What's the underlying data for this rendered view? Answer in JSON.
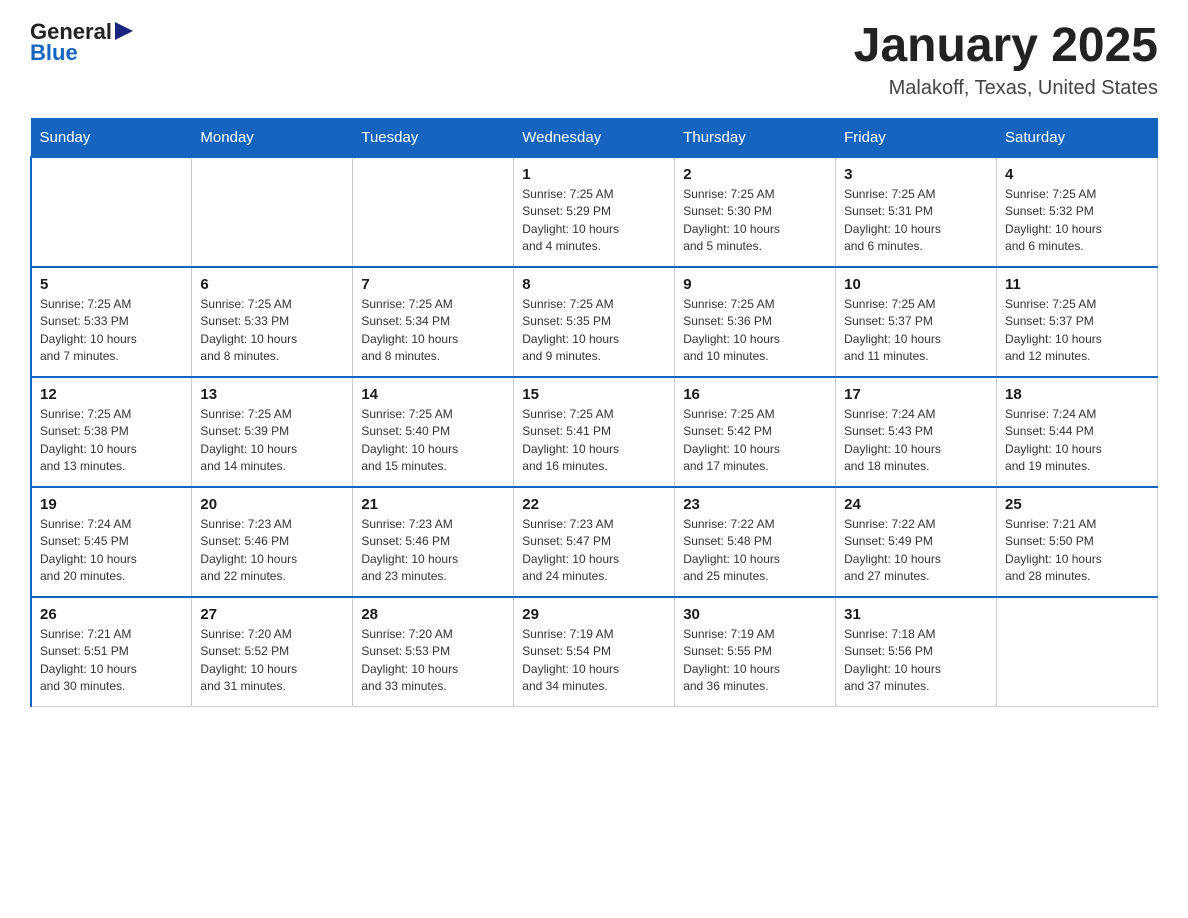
{
  "header": {
    "logo_general": "General",
    "logo_blue": "Blue",
    "calendar_title": "January 2025",
    "calendar_subtitle": "Malakoff, Texas, United States"
  },
  "days_of_week": [
    "Sunday",
    "Monday",
    "Tuesday",
    "Wednesday",
    "Thursday",
    "Friday",
    "Saturday"
  ],
  "weeks": [
    [
      {
        "day": "",
        "info": ""
      },
      {
        "day": "",
        "info": ""
      },
      {
        "day": "",
        "info": ""
      },
      {
        "day": "1",
        "info": "Sunrise: 7:25 AM\nSunset: 5:29 PM\nDaylight: 10 hours\nand 4 minutes."
      },
      {
        "day": "2",
        "info": "Sunrise: 7:25 AM\nSunset: 5:30 PM\nDaylight: 10 hours\nand 5 minutes."
      },
      {
        "day": "3",
        "info": "Sunrise: 7:25 AM\nSunset: 5:31 PM\nDaylight: 10 hours\nand 6 minutes."
      },
      {
        "day": "4",
        "info": "Sunrise: 7:25 AM\nSunset: 5:32 PM\nDaylight: 10 hours\nand 6 minutes."
      }
    ],
    [
      {
        "day": "5",
        "info": "Sunrise: 7:25 AM\nSunset: 5:33 PM\nDaylight: 10 hours\nand 7 minutes."
      },
      {
        "day": "6",
        "info": "Sunrise: 7:25 AM\nSunset: 5:33 PM\nDaylight: 10 hours\nand 8 minutes."
      },
      {
        "day": "7",
        "info": "Sunrise: 7:25 AM\nSunset: 5:34 PM\nDaylight: 10 hours\nand 8 minutes."
      },
      {
        "day": "8",
        "info": "Sunrise: 7:25 AM\nSunset: 5:35 PM\nDaylight: 10 hours\nand 9 minutes."
      },
      {
        "day": "9",
        "info": "Sunrise: 7:25 AM\nSunset: 5:36 PM\nDaylight: 10 hours\nand 10 minutes."
      },
      {
        "day": "10",
        "info": "Sunrise: 7:25 AM\nSunset: 5:37 PM\nDaylight: 10 hours\nand 11 minutes."
      },
      {
        "day": "11",
        "info": "Sunrise: 7:25 AM\nSunset: 5:37 PM\nDaylight: 10 hours\nand 12 minutes."
      }
    ],
    [
      {
        "day": "12",
        "info": "Sunrise: 7:25 AM\nSunset: 5:38 PM\nDaylight: 10 hours\nand 13 minutes."
      },
      {
        "day": "13",
        "info": "Sunrise: 7:25 AM\nSunset: 5:39 PM\nDaylight: 10 hours\nand 14 minutes."
      },
      {
        "day": "14",
        "info": "Sunrise: 7:25 AM\nSunset: 5:40 PM\nDaylight: 10 hours\nand 15 minutes."
      },
      {
        "day": "15",
        "info": "Sunrise: 7:25 AM\nSunset: 5:41 PM\nDaylight: 10 hours\nand 16 minutes."
      },
      {
        "day": "16",
        "info": "Sunrise: 7:25 AM\nSunset: 5:42 PM\nDaylight: 10 hours\nand 17 minutes."
      },
      {
        "day": "17",
        "info": "Sunrise: 7:24 AM\nSunset: 5:43 PM\nDaylight: 10 hours\nand 18 minutes."
      },
      {
        "day": "18",
        "info": "Sunrise: 7:24 AM\nSunset: 5:44 PM\nDaylight: 10 hours\nand 19 minutes."
      }
    ],
    [
      {
        "day": "19",
        "info": "Sunrise: 7:24 AM\nSunset: 5:45 PM\nDaylight: 10 hours\nand 20 minutes."
      },
      {
        "day": "20",
        "info": "Sunrise: 7:23 AM\nSunset: 5:46 PM\nDaylight: 10 hours\nand 22 minutes."
      },
      {
        "day": "21",
        "info": "Sunrise: 7:23 AM\nSunset: 5:46 PM\nDaylight: 10 hours\nand 23 minutes."
      },
      {
        "day": "22",
        "info": "Sunrise: 7:23 AM\nSunset: 5:47 PM\nDaylight: 10 hours\nand 24 minutes."
      },
      {
        "day": "23",
        "info": "Sunrise: 7:22 AM\nSunset: 5:48 PM\nDaylight: 10 hours\nand 25 minutes."
      },
      {
        "day": "24",
        "info": "Sunrise: 7:22 AM\nSunset: 5:49 PM\nDaylight: 10 hours\nand 27 minutes."
      },
      {
        "day": "25",
        "info": "Sunrise: 7:21 AM\nSunset: 5:50 PM\nDaylight: 10 hours\nand 28 minutes."
      }
    ],
    [
      {
        "day": "26",
        "info": "Sunrise: 7:21 AM\nSunset: 5:51 PM\nDaylight: 10 hours\nand 30 minutes."
      },
      {
        "day": "27",
        "info": "Sunrise: 7:20 AM\nSunset: 5:52 PM\nDaylight: 10 hours\nand 31 minutes."
      },
      {
        "day": "28",
        "info": "Sunrise: 7:20 AM\nSunset: 5:53 PM\nDaylight: 10 hours\nand 33 minutes."
      },
      {
        "day": "29",
        "info": "Sunrise: 7:19 AM\nSunset: 5:54 PM\nDaylight: 10 hours\nand 34 minutes."
      },
      {
        "day": "30",
        "info": "Sunrise: 7:19 AM\nSunset: 5:55 PM\nDaylight: 10 hours\nand 36 minutes."
      },
      {
        "day": "31",
        "info": "Sunrise: 7:18 AM\nSunset: 5:56 PM\nDaylight: 10 hours\nand 37 minutes."
      },
      {
        "day": "",
        "info": ""
      }
    ]
  ]
}
